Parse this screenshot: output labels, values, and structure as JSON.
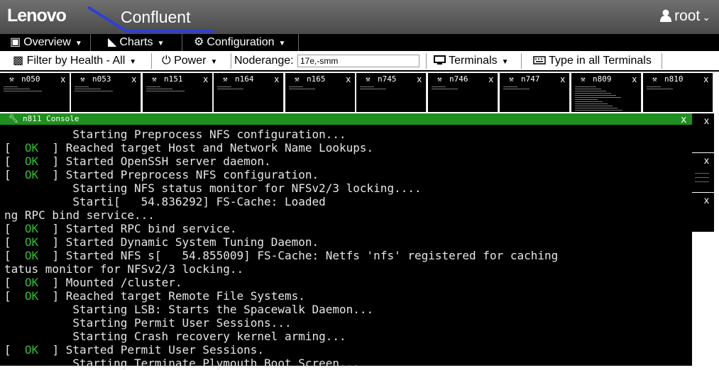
{
  "header": {
    "brand": "Lenovo",
    "app_title": "Confluent",
    "user": "root"
  },
  "menu": {
    "overview": "Overview",
    "charts": "Charts",
    "configuration": "Configuration"
  },
  "toolbar": {
    "filter": "Filter by Health - All",
    "power": "Power",
    "noderange_label": "Noderange:",
    "noderange_value": "17e,-smm",
    "terminals": "Terminals",
    "type_all": "Type in all Terminals"
  },
  "thumbnails": [
    {
      "name": "n050",
      "close": "x"
    },
    {
      "name": "n053",
      "close": "x"
    },
    {
      "name": "n151",
      "close": "x"
    },
    {
      "name": "n164",
      "close": "x"
    },
    {
      "name": "n165",
      "close": "x"
    },
    {
      "name": "n745",
      "close": "x"
    },
    {
      "name": "n746",
      "close": "x"
    },
    {
      "name": "n747",
      "close": "x"
    },
    {
      "name": "n809",
      "close": "x"
    },
    {
      "name": "n810",
      "close": "x"
    }
  ],
  "side_windows": [
    {
      "close": "x"
    },
    {
      "close": "x"
    },
    {
      "close": "x"
    }
  ],
  "console": {
    "title": "n811 Console",
    "close": "x",
    "lines": [
      {
        "pre": "",
        "ok": "",
        "text": "          Starting Preprocess NFS configuration..."
      },
      {
        "pre": "[  ",
        "ok": "OK",
        "text": "  ] Reached target Host and Network Name Lookups."
      },
      {
        "pre": "[  ",
        "ok": "OK",
        "text": "  ] Started OpenSSH server daemon."
      },
      {
        "pre": "[  ",
        "ok": "OK",
        "text": "  ] Started Preprocess NFS configuration."
      },
      {
        "pre": "",
        "ok": "",
        "text": "          Starting NFS status monitor for NFSv2/3 locking...."
      },
      {
        "pre": "",
        "ok": "",
        "text": "          Starti[   54.836292] FS-Cache: Loaded"
      },
      {
        "pre": "",
        "ok": "",
        "text": "ng RPC bind service..."
      },
      {
        "pre": "[  ",
        "ok": "OK",
        "text": "  ] Started RPC bind service."
      },
      {
        "pre": "[  ",
        "ok": "OK",
        "text": "  ] Started Dynamic System Tuning Daemon."
      },
      {
        "pre": "[  ",
        "ok": "OK",
        "text": "  ] Started NFS s[   54.855009] FS-Cache: Netfs 'nfs' registered for caching"
      },
      {
        "pre": "",
        "ok": "",
        "text": "tatus monitor for NFSv2/3 locking.."
      },
      {
        "pre": "[  ",
        "ok": "OK",
        "text": "  ] Mounted /cluster."
      },
      {
        "pre": "[  ",
        "ok": "OK",
        "text": "  ] Reached target Remote File Systems."
      },
      {
        "pre": "",
        "ok": "",
        "text": "          Starting LSB: Starts the Spacewalk Daemon..."
      },
      {
        "pre": "",
        "ok": "",
        "text": "          Starting Permit User Sessions..."
      },
      {
        "pre": "",
        "ok": "",
        "text": "          Starting Crash recovery kernel arming..."
      },
      {
        "pre": "[  ",
        "ok": "OK",
        "text": "  ] Started Permit User Sessions."
      },
      {
        "pre": "",
        "ok": "",
        "text": "          Starting Terminate Plymouth Boot Screen..."
      }
    ]
  }
}
